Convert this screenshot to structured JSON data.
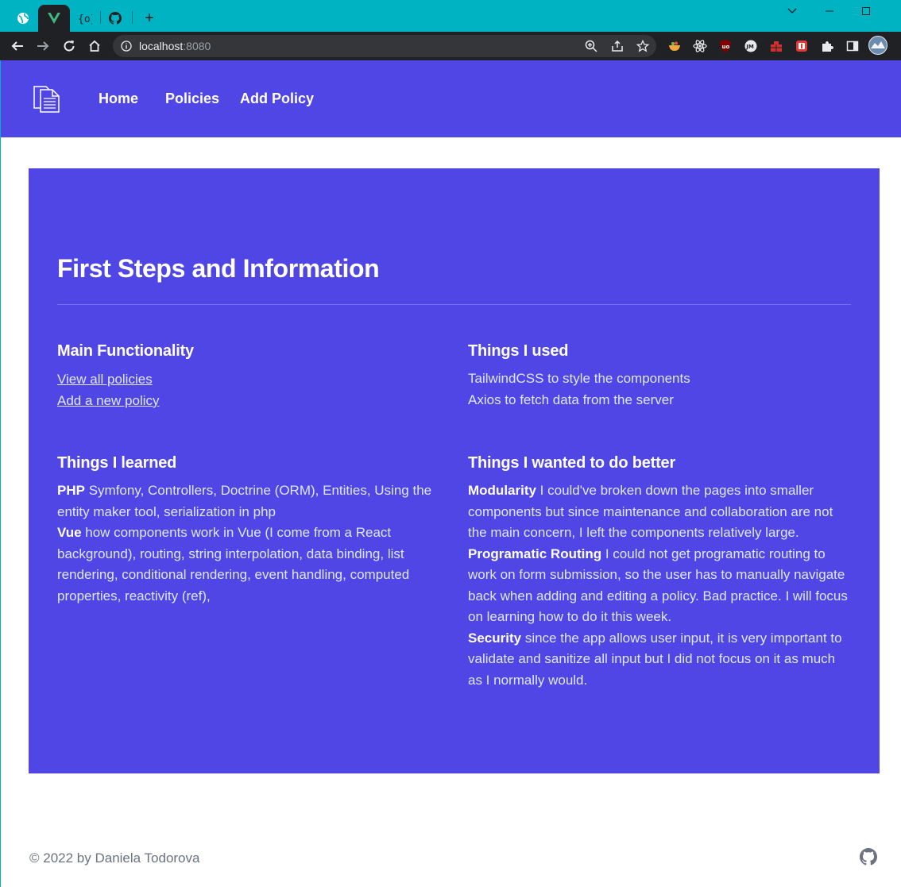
{
  "browser": {
    "tabs": [
      {
        "icon": "globe-icon"
      },
      {
        "icon": "vue-icon",
        "active": true
      },
      {
        "icon": "braces-icon"
      },
      {
        "icon": "github-icon"
      }
    ],
    "new_tab_label": "+",
    "url_host": "localhost",
    "url_port": ":8080",
    "extensions": [
      "zoom-icon",
      "share-icon",
      "star-icon",
      "bowl-extension-icon",
      "react-devtools-icon",
      "ublock-icon",
      "jm-extension-icon",
      "red-extension-icon",
      "red-square-extension-icon",
      "puzzle-icon",
      "sidepanel-icon",
      "profile-avatar"
    ]
  },
  "nav": {
    "links": [
      "Home",
      "Policies",
      "Add Policy"
    ]
  },
  "hero": {
    "title": "First Steps and Information",
    "main_functionality": {
      "heading": "Main Functionality",
      "links": [
        "View all policies",
        "Add a new policy"
      ]
    },
    "things_used": {
      "heading": "Things I used",
      "lines": [
        "TailwindCSS to style the components",
        "Axios to fetch data from the server"
      ]
    },
    "things_learned": {
      "heading": "Things I learned",
      "items": [
        {
          "bold": "PHP",
          "text": " Symfony, Controllers, Doctrine (ORM), Entities, Using the entity maker tool, serialization in php"
        },
        {
          "bold": "Vue",
          "text": " how components work in Vue (I come from a React background), routing, string interpolation, data binding, list rendering, conditional rendering, event handling, computed properties, reactivity (ref),"
        }
      ]
    },
    "do_better": {
      "heading": "Things I wanted to do better",
      "items": [
        {
          "bold": "Modularity",
          "text": " I could've broken down the pages into smaller components but since maintenance and collaboration are not the main concern, I left the components relatively large."
        },
        {
          "bold": "Programatic Routing",
          "text": " I could not get programatic routing to work on form submission, so the user has to manually navigate back when adding and editing a policy. Bad practice. I will focus on learning how to do it this week."
        },
        {
          "bold": "Security",
          "text": " since the app allows user input, it is very important to validate and sanitize all input but I did not focus on it as much as I normally would."
        }
      ]
    }
  },
  "footer": {
    "copyright": "© 2022 by Daniela Todorova",
    "icon": "github-icon"
  },
  "colors": {
    "brand": "#4f46e5",
    "chrome_accent": "#00b3c3"
  }
}
